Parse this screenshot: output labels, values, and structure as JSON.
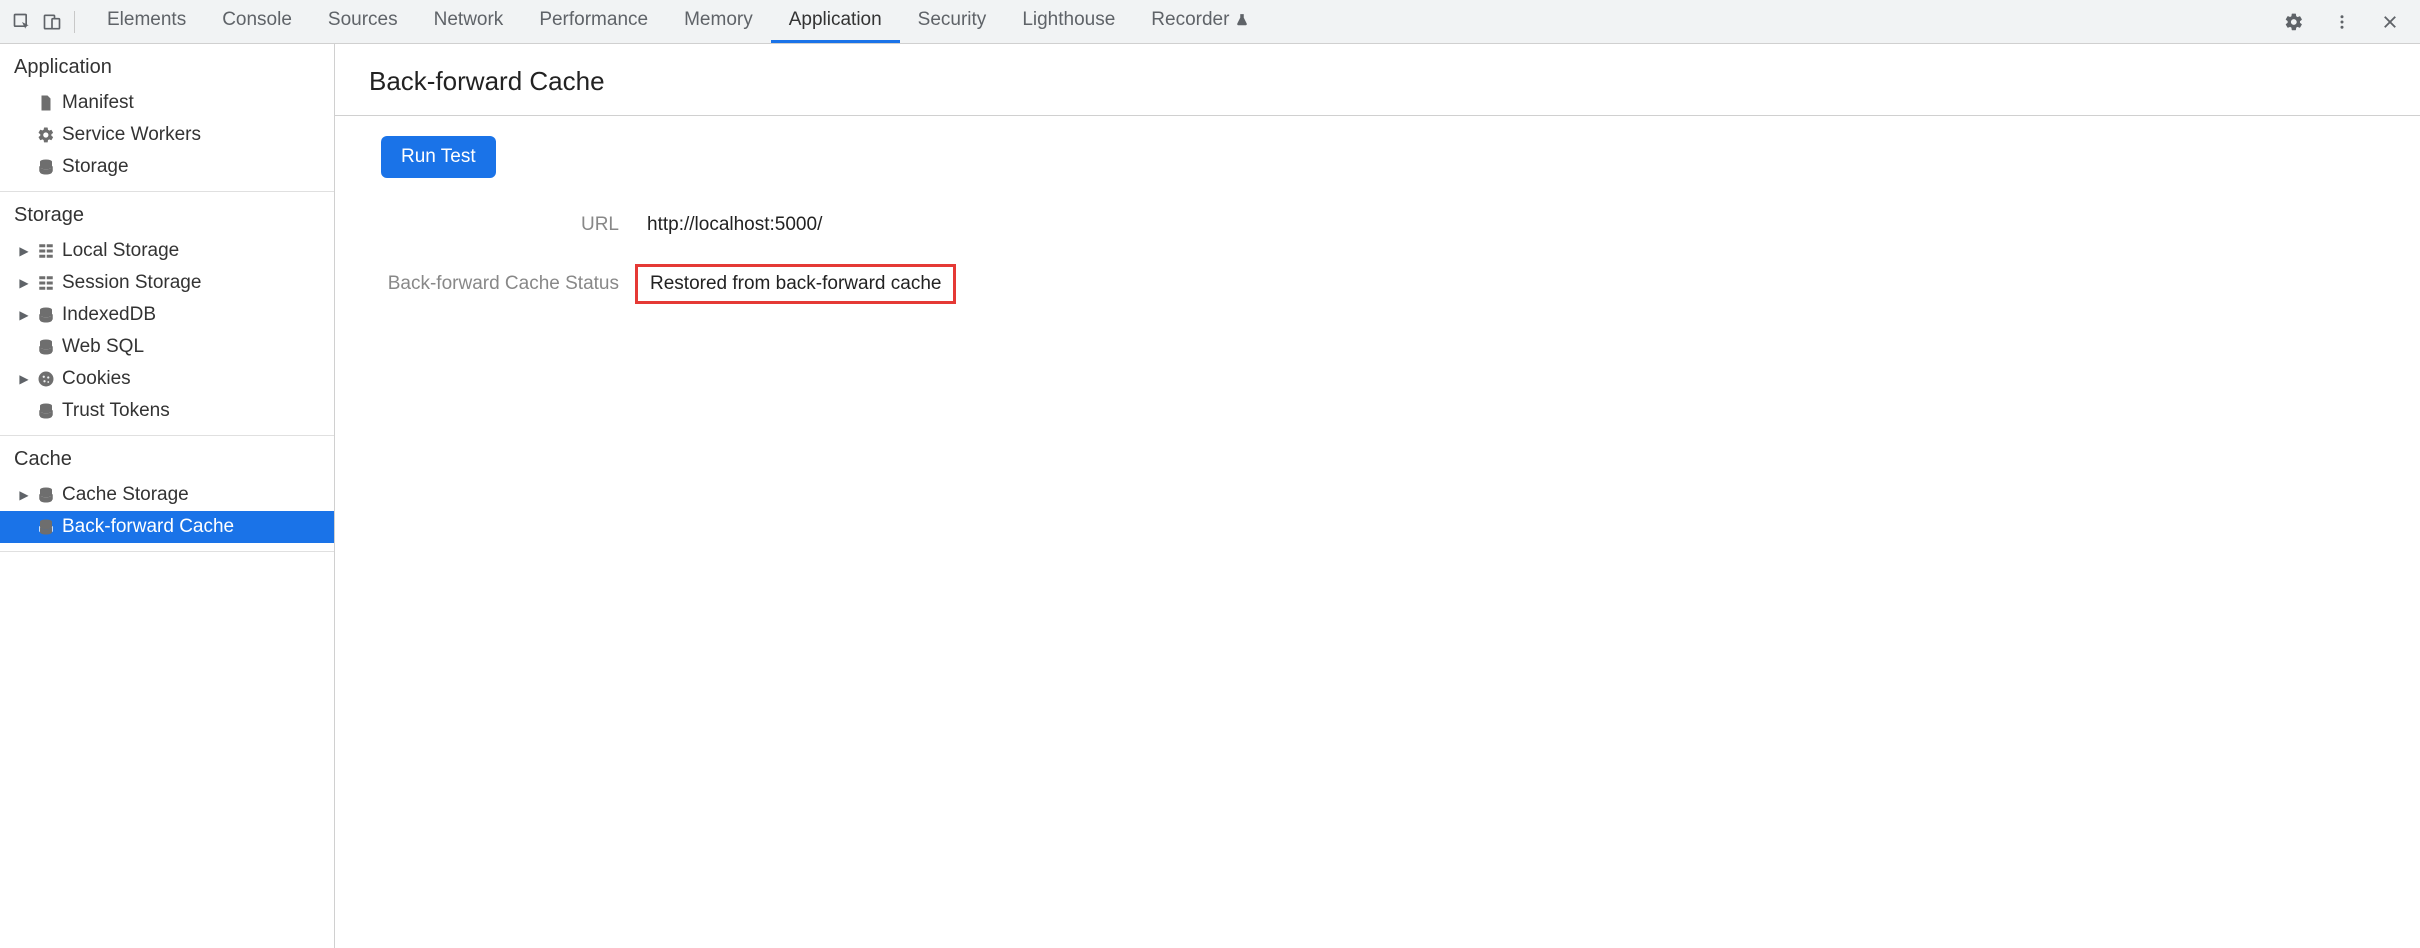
{
  "toolbar": {
    "tabs": [
      {
        "label": "Elements",
        "active": false
      },
      {
        "label": "Console",
        "active": false
      },
      {
        "label": "Sources",
        "active": false
      },
      {
        "label": "Network",
        "active": false
      },
      {
        "label": "Performance",
        "active": false
      },
      {
        "label": "Memory",
        "active": false
      },
      {
        "label": "Application",
        "active": true
      },
      {
        "label": "Security",
        "active": false
      },
      {
        "label": "Lighthouse",
        "active": false
      },
      {
        "label": "Recorder",
        "active": false,
        "flask": true
      }
    ]
  },
  "sidebar": {
    "groups": [
      {
        "title": "Application",
        "items": [
          {
            "label": "Manifest",
            "icon": "file",
            "expandable": false
          },
          {
            "label": "Service Workers",
            "icon": "gear",
            "expandable": false
          },
          {
            "label": "Storage",
            "icon": "db",
            "expandable": false
          }
        ]
      },
      {
        "title": "Storage",
        "items": [
          {
            "label": "Local Storage",
            "icon": "grid",
            "expandable": true
          },
          {
            "label": "Session Storage",
            "icon": "grid",
            "expandable": true
          },
          {
            "label": "IndexedDB",
            "icon": "db",
            "expandable": true
          },
          {
            "label": "Web SQL",
            "icon": "db",
            "expandable": false
          },
          {
            "label": "Cookies",
            "icon": "cookie",
            "expandable": true
          },
          {
            "label": "Trust Tokens",
            "icon": "db",
            "expandable": false
          }
        ]
      },
      {
        "title": "Cache",
        "items": [
          {
            "label": "Cache Storage",
            "icon": "db",
            "expandable": true
          },
          {
            "label": "Back-forward Cache",
            "icon": "db",
            "expandable": false,
            "selected": true
          }
        ]
      }
    ]
  },
  "content": {
    "title": "Back-forward Cache",
    "run_button": "Run Test",
    "rows": [
      {
        "label": "URL",
        "value": "http://localhost:5000/",
        "highlight": false
      },
      {
        "label": "Back-forward Cache Status",
        "value": "Restored from back-forward cache",
        "highlight": true
      }
    ]
  }
}
